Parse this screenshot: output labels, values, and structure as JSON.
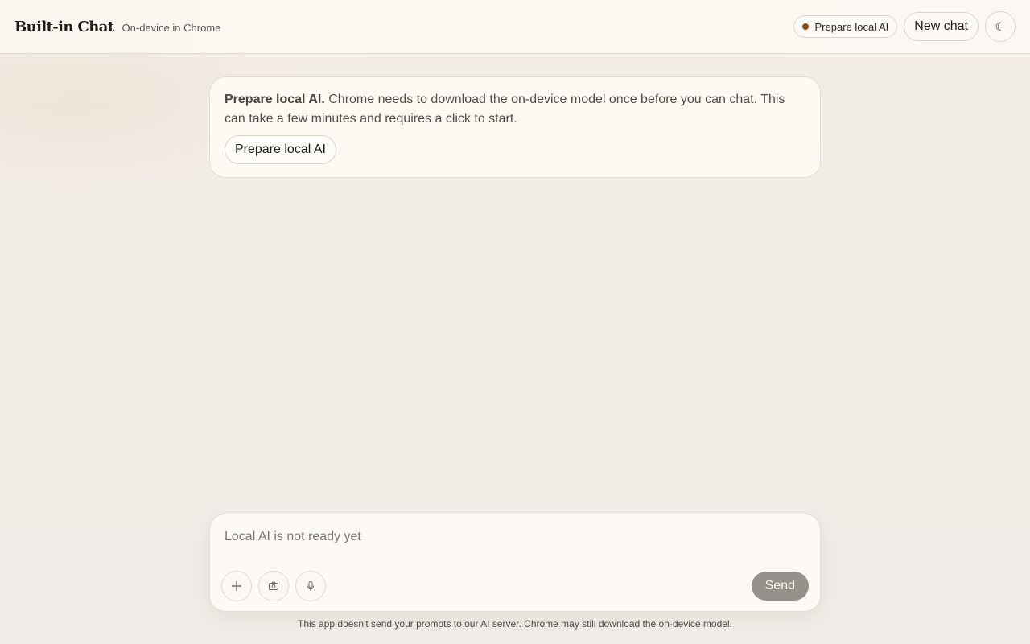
{
  "header": {
    "title": "Built-in Chat",
    "subtitle": "On-device in Chrome",
    "status_label": "Prepare local AI",
    "status_color": "#8a4f17",
    "new_chat_label": "New chat",
    "theme_toggle_icon": "moon-icon",
    "theme_toggle_glyph": "☾"
  },
  "notice": {
    "title": "Prepare local AI.",
    "body": "Chrome needs to download the on-device model once before you can chat. This can take a few minutes and requires a click to start.",
    "button_label": "Prepare local AI"
  },
  "composer": {
    "placeholder": "Local AI is not ready yet",
    "value": "",
    "tools": [
      {
        "icon": "plus-icon"
      },
      {
        "icon": "camera-icon"
      },
      {
        "icon": "microphone-icon"
      }
    ],
    "send_label": "Send"
  },
  "footer": {
    "note": "This app doesn't send your prompts to our AI server. Chrome may still download the on-device model."
  },
  "colors": {
    "background": "#f1ece6",
    "send_button": "#96908a"
  }
}
